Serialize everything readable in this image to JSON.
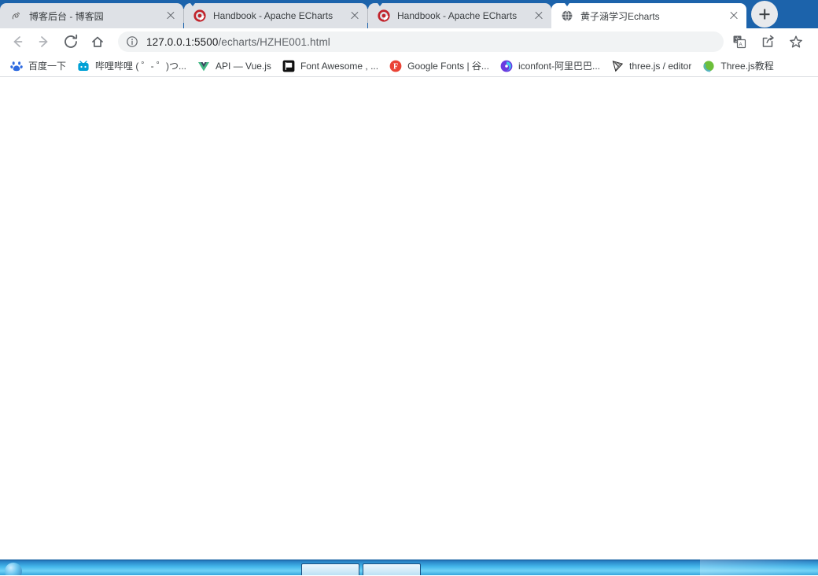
{
  "browser": {
    "tabs": [
      {
        "title": "博客后台 - 博客园",
        "favicon": "cnblogs-icon",
        "active": false
      },
      {
        "title": "Handbook - Apache ECharts",
        "favicon": "echarts-icon",
        "active": false
      },
      {
        "title": "Handbook - Apache ECharts",
        "favicon": "echarts-icon",
        "active": false
      },
      {
        "title": "黄子涵学习Echarts",
        "favicon": "globe-icon",
        "active": true
      }
    ],
    "new_tab_label": "+",
    "toolbar": {
      "back_icon": "back-arrow-icon",
      "forward_icon": "forward-arrow-icon",
      "reload_icon": "reload-icon",
      "home_icon": "home-icon",
      "site_info_icon": "info-circle-icon",
      "url_host": "127.0.0.1:5500",
      "url_path": "/echarts/HZHE001.html",
      "url_full": "127.0.0.1:5500/echarts/HZHE001.html",
      "translate_icon": "translate-icon",
      "share_icon": "share-icon",
      "bookmark_icon": "star-icon"
    },
    "bookmarks": [
      {
        "label": "百度一下",
        "icon": "baidu-icon"
      },
      {
        "label": "哔哩哔哩 ( ゜- ゜)つ...",
        "icon": "bilibili-icon"
      },
      {
        "label": "API — Vue.js",
        "icon": "vuejs-icon"
      },
      {
        "label": "Font Awesome , ...",
        "icon": "fontawesome-flag-icon"
      },
      {
        "label": "Google Fonts | 谷...",
        "icon": "googlefonts-icon"
      },
      {
        "label": "iconfont-阿里巴巴...",
        "icon": "iconfont-icon"
      },
      {
        "label": "three.js / editor",
        "icon": "threejs-icon"
      },
      {
        "label": "Three.js教程",
        "icon": "threejs-tutorial-icon"
      }
    ]
  },
  "page": {
    "content": ""
  },
  "taskbar": {
    "start_label": "",
    "buttons": [
      "",
      ""
    ]
  },
  "colors": {
    "tabstrip_blue": "#1c63ab",
    "inactive_tab": "#dee1e6",
    "active_tab": "#ffffff",
    "omnibox": "#f1f3f4",
    "url_host_text": "#202124",
    "url_path_text": "#5f6368",
    "bookmark_text": "#3c4043",
    "separator": "#dadce0",
    "taskbar_blue": "#43b6ea"
  }
}
